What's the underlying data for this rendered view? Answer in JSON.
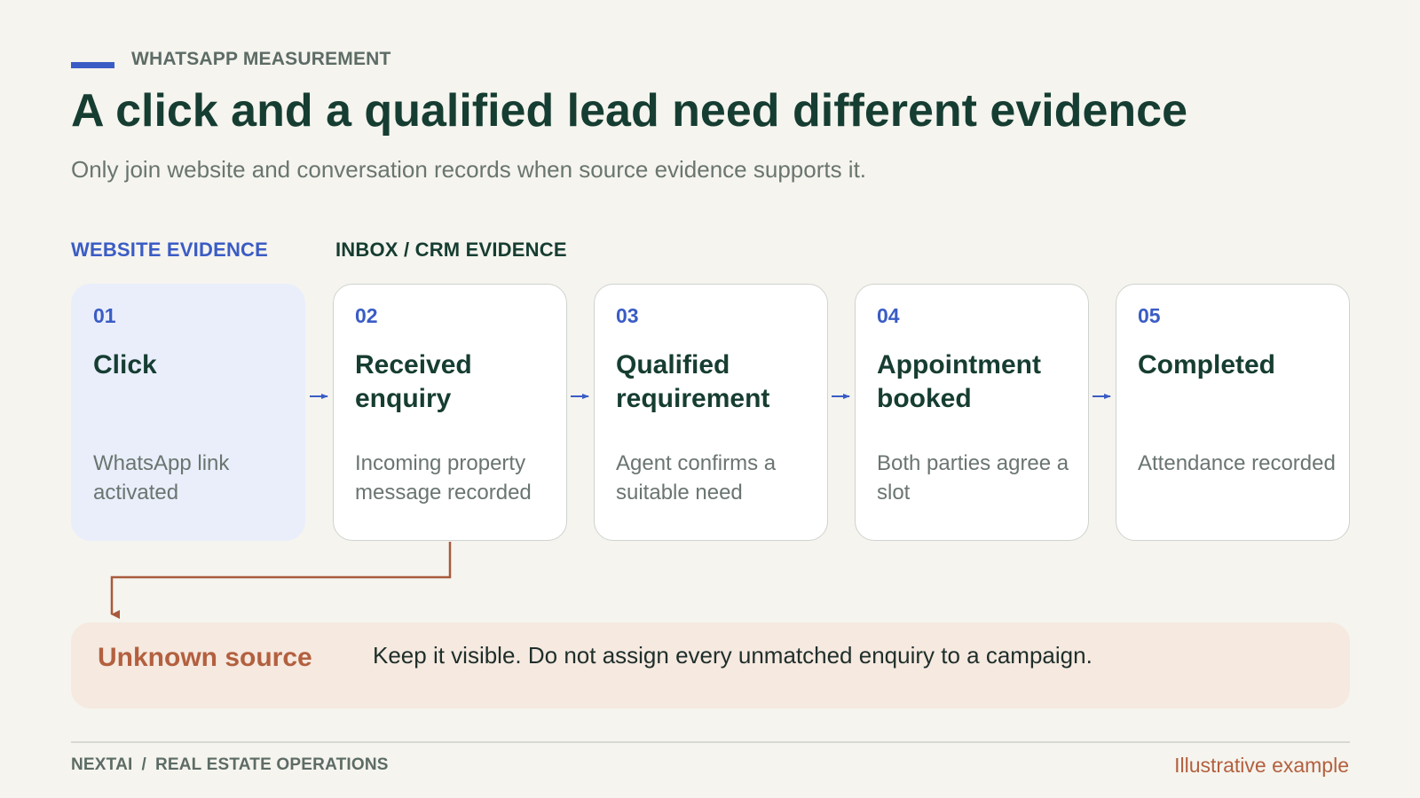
{
  "header": {
    "kicker": "WHATSAPP MEASUREMENT",
    "title": "A click and a qualified lead need different evidence",
    "subtitle": "Only join website and conversation records when source evidence supports it."
  },
  "sections": {
    "website_label": "WEBSITE EVIDENCE",
    "crm_label": "INBOX / CRM EVIDENCE"
  },
  "steps": [
    {
      "num": "01",
      "name": "Click",
      "desc": "WhatsApp link activated"
    },
    {
      "num": "02",
      "name": "Received enquiry",
      "desc": "Incoming property message recorded"
    },
    {
      "num": "03",
      "name": "Qualified requirement",
      "desc": "Agent confirms a suitable need"
    },
    {
      "num": "04",
      "name": "Appointment booked",
      "desc": "Both parties agree a slot"
    },
    {
      "num": "05",
      "name": "Completed",
      "desc": "Attendance recorded"
    }
  ],
  "unknown": {
    "title": "Unknown source",
    "text": "Keep it visible. Do not assign every unmatched enquiry to a campaign."
  },
  "footer": {
    "brand": "NEXTAI",
    "separator": "/",
    "section": "REAL ESTATE OPERATIONS",
    "note": "Illustrative example"
  },
  "colors": {
    "background": "#f5f4ee",
    "title": "#163d32",
    "accent_blue": "#3a5cc5",
    "website_card": "#e9eefa",
    "warning_text": "#b3603f",
    "warning_box": "#f5e9e0"
  }
}
